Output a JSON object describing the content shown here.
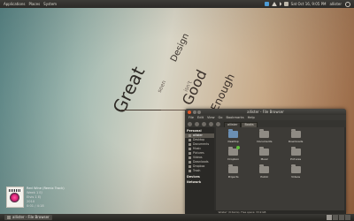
{
  "top_panel": {
    "menus": [
      "Applications",
      "Places",
      "System"
    ],
    "clock": "Sat Oct 16, 9:05 PM",
    "user": "allister"
  },
  "wallpaper": {
    "words": {
      "great": "Great",
      "design": "Design",
      "seen": "seen",
      "good": "Good",
      "isnt": "isn't",
      "enough": "Enough"
    }
  },
  "music": {
    "title": "Red Wine (Remix Track)",
    "line2": "Week 1 EJ",
    "line3": "Elvis 1 EJ",
    "line4": "2010",
    "time": "0:01 / 4:18"
  },
  "window": {
    "title": "allister - File Browser",
    "menus": [
      "File",
      "Edit",
      "View",
      "Go",
      "Bookmarks",
      "Help"
    ],
    "path": [
      "allister",
      "Books"
    ],
    "sidebar_personal": "Personal",
    "sidebar_items": [
      "allister",
      "Desktop",
      "Documents",
      "Music",
      "Pictures",
      "Videos",
      "Downloads",
      "Dropbox",
      "Trash"
    ],
    "sidebar_devices": "Devices",
    "sidebar_network": "Network",
    "files": [
      "Desktop",
      "Documents",
      "Downloads",
      "Dropbox",
      "Music",
      "Pictures",
      "Projects",
      "Public",
      "Videos"
    ],
    "status": "'allister' (9 items), Free space: 33.9 GB"
  },
  "bottom_panel": {
    "task": "allister - File Browser"
  }
}
